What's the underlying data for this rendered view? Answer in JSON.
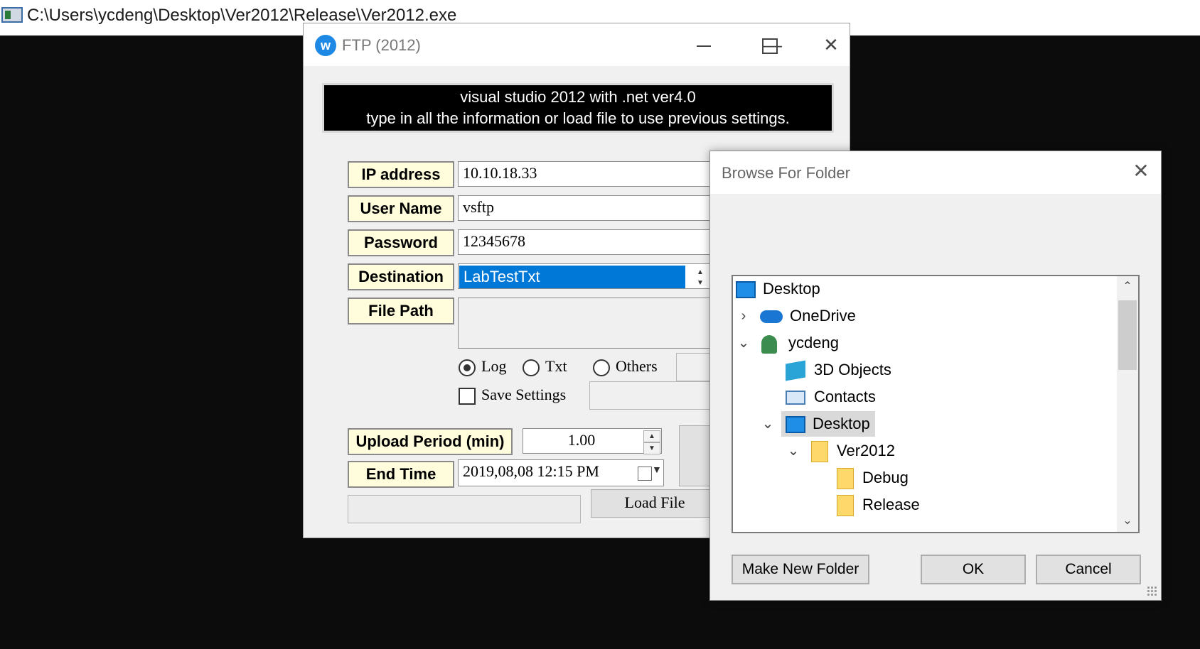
{
  "console": {
    "title": "C:\\Users\\ycdeng\\Desktop\\Ver2012\\Release\\Ver2012.exe"
  },
  "ftp": {
    "title": "FTP (2012)",
    "banner": [
      "visual studio 2012 with .net ver4.0",
      "type in all the information or load file to use previous settings."
    ],
    "labels": {
      "ip": "IP address",
      "user": "User Name",
      "password": "Password",
      "destination": "Destination",
      "file_path": "File Path",
      "upload_period": "Upload Period (min)",
      "end_time": "End Time"
    },
    "values": {
      "ip": "10.10.18.33",
      "user": "vsftp",
      "password": "12345678",
      "destination": "LabTestTxt",
      "upload_period": "1.00",
      "end_time": "2019,08,08 12:15 PM"
    },
    "options": {
      "log": "Log",
      "txt": "Txt",
      "others": "Others",
      "save": "Save Settings",
      "selected": "Log",
      "save_checked": false
    },
    "buttons": {
      "load_file": "Load File"
    }
  },
  "browse": {
    "title": "Browse For Folder",
    "tree": [
      {
        "label": "Desktop",
        "icon": "desktop-icon",
        "selected": false
      },
      {
        "label": "OneDrive",
        "icon": "cloud-icon",
        "expander": "collapsed"
      },
      {
        "label": "ycdeng",
        "icon": "user-icon",
        "expander": "expanded"
      },
      {
        "label": "3D Objects",
        "icon": "cube-icon"
      },
      {
        "label": "Contacts",
        "icon": "contact-card-icon"
      },
      {
        "label": "Desktop",
        "icon": "desktop-icon",
        "expander": "expanded",
        "selected": true
      },
      {
        "label": "Ver2012",
        "icon": "folder-icon",
        "expander": "expanded"
      },
      {
        "label": "Debug",
        "icon": "folder-icon"
      },
      {
        "label": "Release",
        "icon": "folder-icon"
      }
    ],
    "buttons": {
      "new_folder": "Make New Folder",
      "ok": "OK",
      "cancel": "Cancel"
    }
  }
}
